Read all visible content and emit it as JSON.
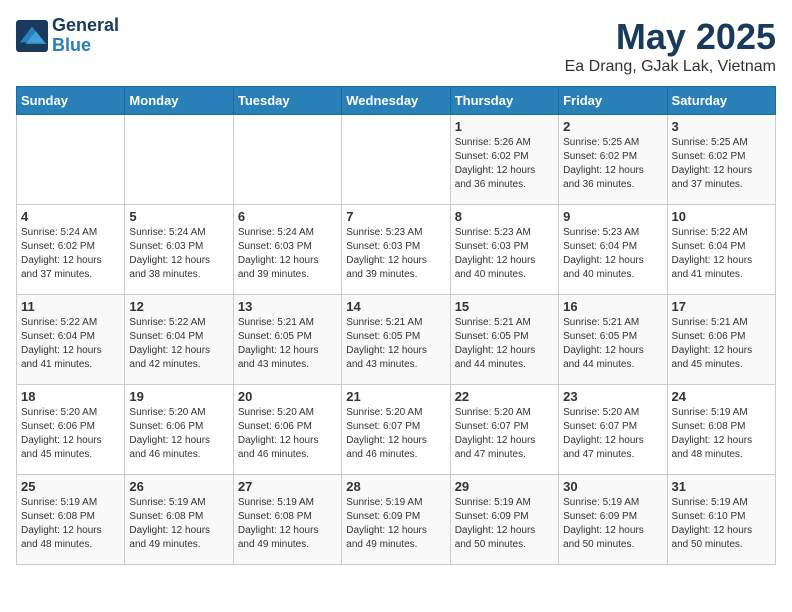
{
  "logo": {
    "line1": "General",
    "line2": "Blue"
  },
  "title": "May 2025",
  "subtitle": "Ea Drang, GJak Lak, Vietnam",
  "days_of_week": [
    "Sunday",
    "Monday",
    "Tuesday",
    "Wednesday",
    "Thursday",
    "Friday",
    "Saturday"
  ],
  "weeks": [
    [
      {
        "day": "",
        "info": ""
      },
      {
        "day": "",
        "info": ""
      },
      {
        "day": "",
        "info": ""
      },
      {
        "day": "",
        "info": ""
      },
      {
        "day": "1",
        "info": "Sunrise: 5:26 AM\nSunset: 6:02 PM\nDaylight: 12 hours\nand 36 minutes."
      },
      {
        "day": "2",
        "info": "Sunrise: 5:25 AM\nSunset: 6:02 PM\nDaylight: 12 hours\nand 36 minutes."
      },
      {
        "day": "3",
        "info": "Sunrise: 5:25 AM\nSunset: 6:02 PM\nDaylight: 12 hours\nand 37 minutes."
      }
    ],
    [
      {
        "day": "4",
        "info": "Sunrise: 5:24 AM\nSunset: 6:02 PM\nDaylight: 12 hours\nand 37 minutes."
      },
      {
        "day": "5",
        "info": "Sunrise: 5:24 AM\nSunset: 6:03 PM\nDaylight: 12 hours\nand 38 minutes."
      },
      {
        "day": "6",
        "info": "Sunrise: 5:24 AM\nSunset: 6:03 PM\nDaylight: 12 hours\nand 39 minutes."
      },
      {
        "day": "7",
        "info": "Sunrise: 5:23 AM\nSunset: 6:03 PM\nDaylight: 12 hours\nand 39 minutes."
      },
      {
        "day": "8",
        "info": "Sunrise: 5:23 AM\nSunset: 6:03 PM\nDaylight: 12 hours\nand 40 minutes."
      },
      {
        "day": "9",
        "info": "Sunrise: 5:23 AM\nSunset: 6:04 PM\nDaylight: 12 hours\nand 40 minutes."
      },
      {
        "day": "10",
        "info": "Sunrise: 5:22 AM\nSunset: 6:04 PM\nDaylight: 12 hours\nand 41 minutes."
      }
    ],
    [
      {
        "day": "11",
        "info": "Sunrise: 5:22 AM\nSunset: 6:04 PM\nDaylight: 12 hours\nand 41 minutes."
      },
      {
        "day": "12",
        "info": "Sunrise: 5:22 AM\nSunset: 6:04 PM\nDaylight: 12 hours\nand 42 minutes."
      },
      {
        "day": "13",
        "info": "Sunrise: 5:21 AM\nSunset: 6:05 PM\nDaylight: 12 hours\nand 43 minutes."
      },
      {
        "day": "14",
        "info": "Sunrise: 5:21 AM\nSunset: 6:05 PM\nDaylight: 12 hours\nand 43 minutes."
      },
      {
        "day": "15",
        "info": "Sunrise: 5:21 AM\nSunset: 6:05 PM\nDaylight: 12 hours\nand 44 minutes."
      },
      {
        "day": "16",
        "info": "Sunrise: 5:21 AM\nSunset: 6:05 PM\nDaylight: 12 hours\nand 44 minutes."
      },
      {
        "day": "17",
        "info": "Sunrise: 5:21 AM\nSunset: 6:06 PM\nDaylight: 12 hours\nand 45 minutes."
      }
    ],
    [
      {
        "day": "18",
        "info": "Sunrise: 5:20 AM\nSunset: 6:06 PM\nDaylight: 12 hours\nand 45 minutes."
      },
      {
        "day": "19",
        "info": "Sunrise: 5:20 AM\nSunset: 6:06 PM\nDaylight: 12 hours\nand 46 minutes."
      },
      {
        "day": "20",
        "info": "Sunrise: 5:20 AM\nSunset: 6:06 PM\nDaylight: 12 hours\nand 46 minutes."
      },
      {
        "day": "21",
        "info": "Sunrise: 5:20 AM\nSunset: 6:07 PM\nDaylight: 12 hours\nand 46 minutes."
      },
      {
        "day": "22",
        "info": "Sunrise: 5:20 AM\nSunset: 6:07 PM\nDaylight: 12 hours\nand 47 minutes."
      },
      {
        "day": "23",
        "info": "Sunrise: 5:20 AM\nSunset: 6:07 PM\nDaylight: 12 hours\nand 47 minutes."
      },
      {
        "day": "24",
        "info": "Sunrise: 5:19 AM\nSunset: 6:08 PM\nDaylight: 12 hours\nand 48 minutes."
      }
    ],
    [
      {
        "day": "25",
        "info": "Sunrise: 5:19 AM\nSunset: 6:08 PM\nDaylight: 12 hours\nand 48 minutes."
      },
      {
        "day": "26",
        "info": "Sunrise: 5:19 AM\nSunset: 6:08 PM\nDaylight: 12 hours\nand 49 minutes."
      },
      {
        "day": "27",
        "info": "Sunrise: 5:19 AM\nSunset: 6:08 PM\nDaylight: 12 hours\nand 49 minutes."
      },
      {
        "day": "28",
        "info": "Sunrise: 5:19 AM\nSunset: 6:09 PM\nDaylight: 12 hours\nand 49 minutes."
      },
      {
        "day": "29",
        "info": "Sunrise: 5:19 AM\nSunset: 6:09 PM\nDaylight: 12 hours\nand 50 minutes."
      },
      {
        "day": "30",
        "info": "Sunrise: 5:19 AM\nSunset: 6:09 PM\nDaylight: 12 hours\nand 50 minutes."
      },
      {
        "day": "31",
        "info": "Sunrise: 5:19 AM\nSunset: 6:10 PM\nDaylight: 12 hours\nand 50 minutes."
      }
    ]
  ]
}
